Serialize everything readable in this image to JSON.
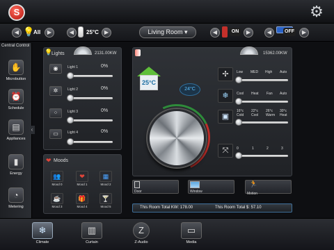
{
  "top": {
    "logo_text": "S",
    "settings_icon": "gear-icon"
  },
  "controls": {
    "light_all_label": "All",
    "temp_label": "25°C",
    "room_selected": "Living Room",
    "power_label": "ON",
    "display_label": "OFF"
  },
  "sidebar": {
    "title": "Central Control",
    "items": [
      {
        "label": "Microbutton",
        "icon": "microbutton-icon"
      },
      {
        "label": "Schedule",
        "icon": "alarm-clock-icon"
      },
      {
        "label": "Appliances",
        "icon": "appliance-icon"
      },
      {
        "label": "Energy",
        "icon": "battery-icon"
      },
      {
        "label": "Metering",
        "icon": "meter-icon"
      }
    ]
  },
  "lights": {
    "title": "Lights",
    "kw": "2131.00KW",
    "items": [
      {
        "name": "Light 1",
        "value": "0%",
        "level": 0
      },
      {
        "name": "Light 2",
        "value": "0%",
        "level": 0
      },
      {
        "name": "Light 3",
        "value": "0%",
        "level": 0
      },
      {
        "name": "Light 4",
        "value": "0%",
        "level": 0
      }
    ]
  },
  "moods": {
    "title": "Moods",
    "items": [
      {
        "label": "Mood 0",
        "glyph": "👥"
      },
      {
        "label": "Mood 1",
        "glyph": "❤"
      },
      {
        "label": "Mood 2",
        "glyph": "▦"
      },
      {
        "label": "Mood 3",
        "glyph": "☕"
      },
      {
        "label": "Mood 4",
        "glyph": "🎁"
      },
      {
        "label": "Mood 5",
        "glyph": "🍸"
      }
    ]
  },
  "climate": {
    "kw": "15362.00KW",
    "outdoor_temp": "25°C",
    "set_temp": "24°C",
    "fan_speed": {
      "labels": [
        "Low",
        "MED",
        "High",
        "Auto"
      ]
    },
    "mode": {
      "labels": [
        "Cool",
        "Heat",
        "Fan",
        "Auto"
      ]
    },
    "presets": {
      "labels": [
        "16°c Cold",
        "22°c Cool",
        "26°c Warm",
        "30°c Heat"
      ]
    },
    "swing": {
      "labels": [
        "0",
        "1",
        "2",
        "3"
      ]
    }
  },
  "bottom_buttons": [
    {
      "label": "Door"
    },
    {
      "label": "Window"
    },
    {
      "label": "Motion"
    }
  ],
  "summary": {
    "kw_text": "This Room Total KW: 178.00",
    "cost_text": "This Room Total $: 57.10"
  },
  "tabs": [
    {
      "label": "Climate",
      "glyph": "❄"
    },
    {
      "label": "Curtain",
      "glyph": "▥"
    },
    {
      "label": "Z-Audio",
      "glyph": "Z"
    },
    {
      "label": "Media",
      "glyph": "▭"
    }
  ]
}
